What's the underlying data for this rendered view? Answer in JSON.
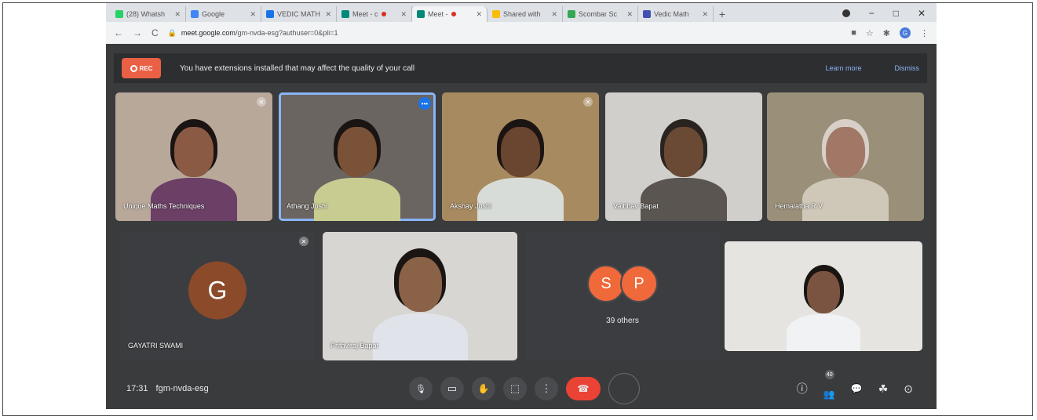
{
  "tabs": [
    {
      "title": "(28) Whatsh",
      "color": "#25d366",
      "active": false
    },
    {
      "title": "Google",
      "color": "#4285f4",
      "active": false
    },
    {
      "title": "VEDIC MATH",
      "color": "#1a73e8",
      "active": false
    },
    {
      "title": "Meet - c",
      "color": "#00897b",
      "active": false,
      "recording": true
    },
    {
      "title": "Meet -",
      "color": "#00897b",
      "active": true,
      "recording": true
    },
    {
      "title": "Shared with",
      "color": "#fbbc04",
      "active": false
    },
    {
      "title": "Scombar Sc",
      "color": "#34a853",
      "active": false
    },
    {
      "title": "Vedic Math",
      "color": "#3f51b5",
      "active": false
    }
  ],
  "window_controls": {
    "minimize": "−",
    "maximize": "□",
    "close": "✕"
  },
  "url": {
    "host": "meet.google.com",
    "path": "/gm-nvda-esg?authuser=0&pli=1"
  },
  "toolbar_avatar": "G",
  "banner": {
    "badge": "REC",
    "text": "You have extensions installed that may affect the quality of your call",
    "learn_more": "Learn more",
    "dismiss": "Dismiss"
  },
  "participants": [
    {
      "name": "Unique Maths Techniques",
      "bg": "#b8a89a",
      "skin": "#8a5a45",
      "shirt": "#6b3f66",
      "hair": "#1a1412",
      "pinned": true
    },
    {
      "name": "Athang Joshi",
      "bg": "#6b6561",
      "skin": "#7a5238",
      "shirt": "#c8cc90",
      "hair": "#1a1412",
      "active": true
    },
    {
      "name": "Akshay Joshi",
      "bg": "#a88a60",
      "skin": "#6a4530",
      "shirt": "#d8dcd8",
      "hair": "#1a1412",
      "pinned": true
    },
    {
      "name": "Vaibhav Bapat",
      "bg": "#d0cfcb",
      "skin": "#6b4a35",
      "shirt": "#5a5550",
      "hair": "#2a2420"
    },
    {
      "name": "Hemalatha R V",
      "bg": "#9a8f78",
      "skin": "#a07865",
      "shirt": "#cfc8b8",
      "hair": "#d8d0c8"
    }
  ],
  "row2": {
    "letter_tile": {
      "letter": "G",
      "name": "GAYATRI SWAMI"
    },
    "video_tile": {
      "name": "Prithviraj Bapat",
      "bg": "#d8d6d2",
      "skin": "#8a6248",
      "shirt": "#e0e4ea",
      "hair": "#1a1412"
    },
    "others_tile": {
      "initials": [
        "S",
        "P"
      ],
      "label": "39 others"
    },
    "woman_tile": {
      "bg": "#e6e4e0",
      "skin": "#7a5440",
      "shirt": "#f0f2f4",
      "hair": "#1a1412"
    }
  },
  "bottom": {
    "time": "17:31",
    "code": "fgm-nvda-esg",
    "participants_count": "40"
  },
  "icons": {
    "mic": "🎙",
    "camera": "▭",
    "hand": "✋",
    "present": "⬚",
    "more": "⋮",
    "hangup": "☎",
    "info": "ⓘ",
    "people": "👥",
    "chat": "💬",
    "activities": "☘",
    "lock": "🔒"
  }
}
